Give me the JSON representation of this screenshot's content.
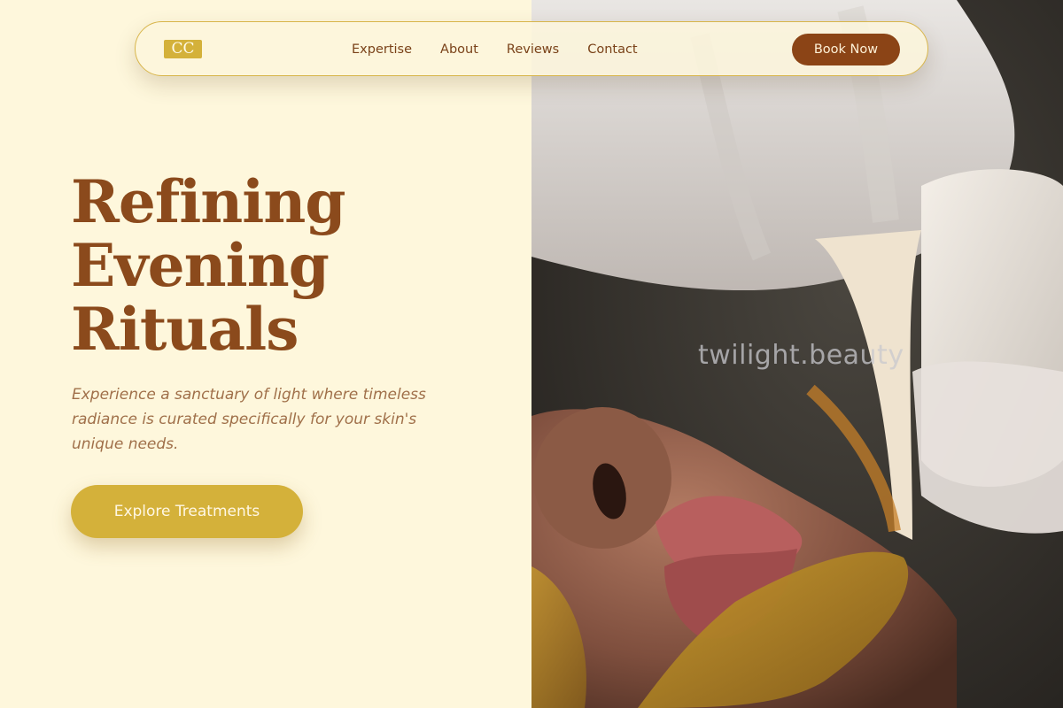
{
  "nav": {
    "logo": "CC",
    "links": [
      "Expertise",
      "About",
      "Reviews",
      "Contact"
    ],
    "book_label": "Book Now"
  },
  "hero": {
    "title_lines": [
      "Refining",
      "Evening",
      "Rituals"
    ],
    "subtitle": "Experience a sanctuary of light where timeless radiance is curated specifically for your skin's unique needs.",
    "cta_label": "Explore Treatments"
  },
  "photo": {
    "watermark": "twilight.beauty"
  },
  "colors": {
    "background": "#fef7dc",
    "brand_brown": "#8b4416",
    "gold": "#d4b13a",
    "text_muted": "#a0704a"
  }
}
